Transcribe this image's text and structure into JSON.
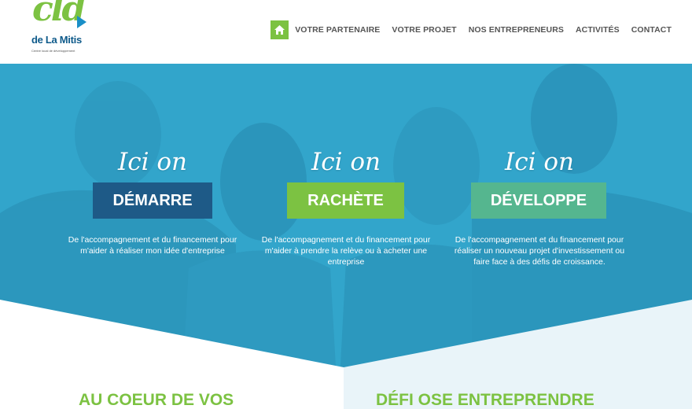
{
  "logo": {
    "mark": "cld",
    "name": "de La Mitis",
    "tagline": "Centre local de développement"
  },
  "nav": {
    "home_icon": "home-icon",
    "items": [
      {
        "label": "VOTRE PARTENAIRE"
      },
      {
        "label": "VOTRE PROJET"
      },
      {
        "label": "NOS ENTREPRENEURS"
      },
      {
        "label": "ACTIVITÉS"
      },
      {
        "label": "CONTACT"
      }
    ]
  },
  "hero": {
    "columns": [
      {
        "prefix": "Ici on",
        "verb": "DÉMARRE",
        "description": "De l'accompagnement et du financement pour m'aider à réaliser mon idée d'entreprise"
      },
      {
        "prefix": "Ici on",
        "verb": "RACHÈTE",
        "description": "De l'accompagnement et du financement pour m'aider à prendre la relève ou à acheter une entreprise"
      },
      {
        "prefix": "Ici on",
        "verb": "DÉVELOPPE",
        "description": "De l'accompagnement et du financement pour réaliser un nouveau projet d'investissement ou faire face à des défis de croissance."
      }
    ]
  },
  "sections": {
    "left_heading": "AU COEUR DE VOS",
    "right_heading": "DÉFI OSE ENTREPRENDRE"
  },
  "colors": {
    "brand_green": "#7cc242",
    "brand_blue": "#1e5a87",
    "teal": "#55b68f",
    "hero_overlay": "#2ea2c9",
    "pale_blue": "#e9f4f9"
  }
}
